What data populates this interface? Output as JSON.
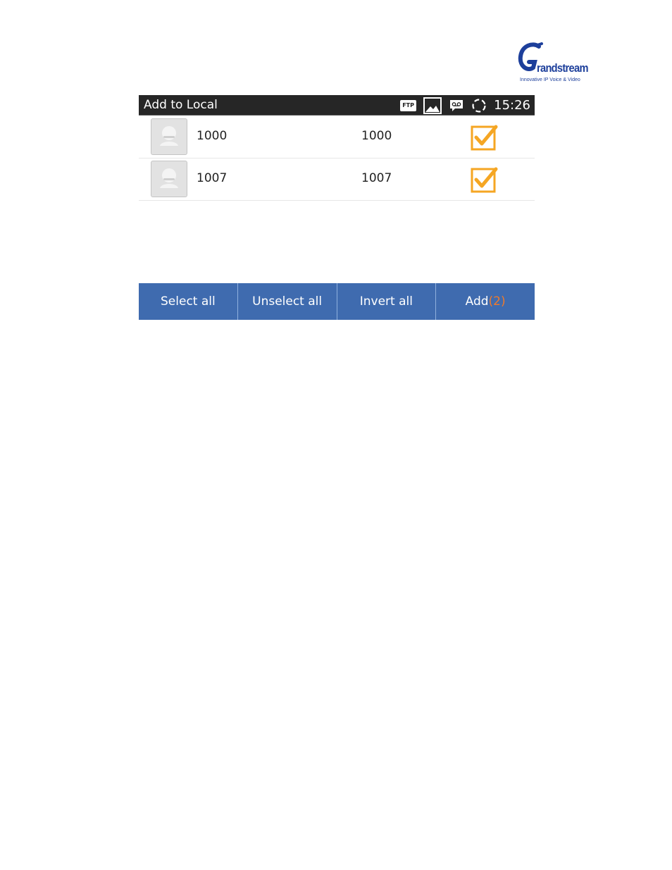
{
  "logo": {
    "brand_tail": "randstream",
    "tagline": "Innovative IP Voice & Video",
    "color": "#1d3f9b"
  },
  "statusbar": {
    "title": "Add to Local",
    "ftp_label": "FTP",
    "time": "15:26",
    "icons": [
      "ftp-icon",
      "picture-icon",
      "voicemail-icon",
      "sync-icon"
    ]
  },
  "contacts": [
    {
      "name": "1000",
      "number": "1000",
      "checked": true
    },
    {
      "name": "1007",
      "number": "1007",
      "checked": true
    }
  ],
  "toolbar": {
    "select_all": "Select all",
    "unselect_all": "Unselect all",
    "invert_all": "Invert all",
    "add_label": "Add",
    "add_count": "(2)"
  },
  "colors": {
    "toolbar_bg": "#3f6baf",
    "check_color": "#f5a623",
    "count_color": "#f07a2a",
    "statusbar_bg": "#262626"
  }
}
